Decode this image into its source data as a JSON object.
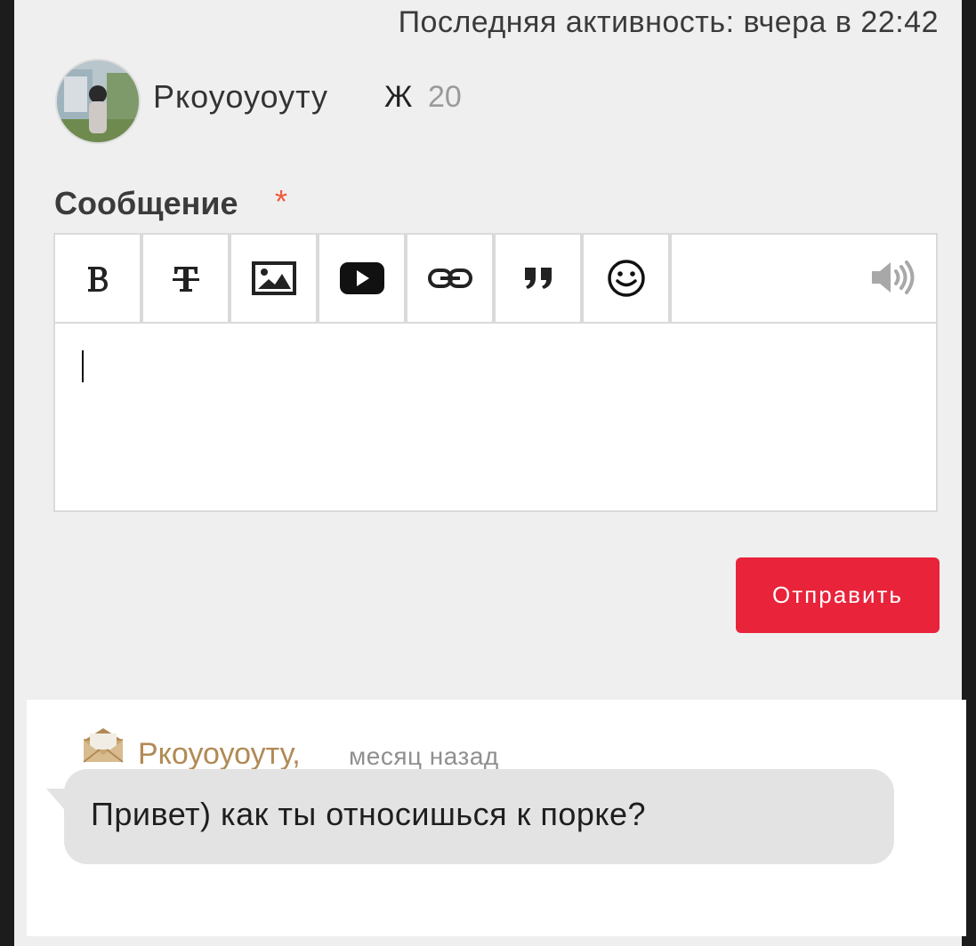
{
  "header": {
    "last_activity": "Последняя активность: вчера в 22:42"
  },
  "profile": {
    "name": "Ркоуоуоуту",
    "gender": "Ж",
    "age": "20"
  },
  "form": {
    "label": "Сообщение",
    "required_mark": "*",
    "toolbar": [
      "bold-icon",
      "strikethrough-icon",
      "image-icon",
      "video-icon",
      "link-icon",
      "quote-icon",
      "smiley-icon",
      "sound-icon"
    ],
    "send_label": "Отправить"
  },
  "conversation": {
    "sender": "Ркоуоуоуту,",
    "time": "месяц назад",
    "message": "Привет) как ты относишься к порке?"
  },
  "colors": {
    "accent": "#e8233a",
    "sender_name": "#b18a55",
    "required": "#ef5a3b"
  }
}
